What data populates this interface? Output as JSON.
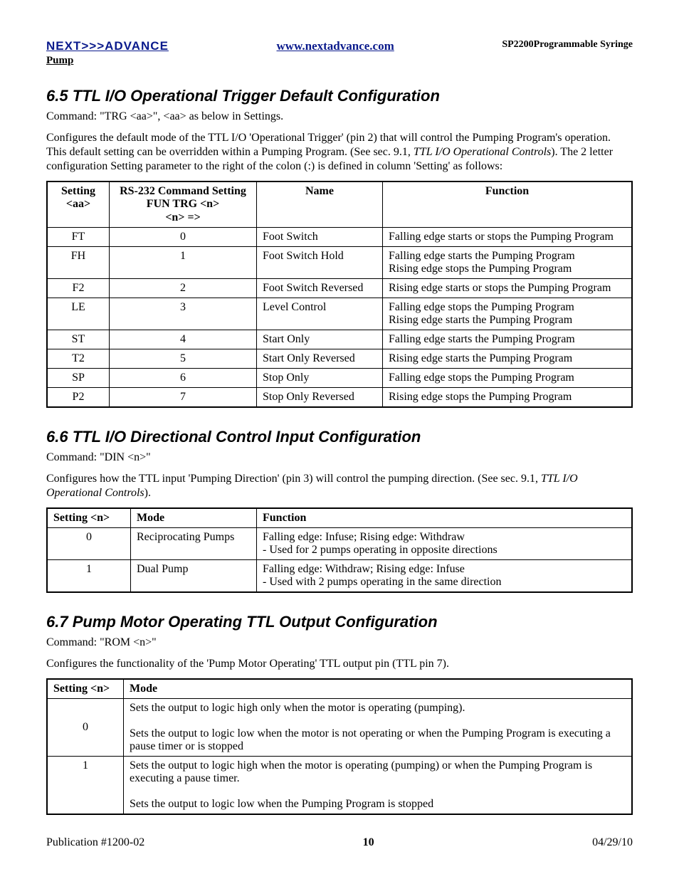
{
  "header": {
    "brand": "NEXT>>>ADVANCE",
    "url": "www.nextadvance.com",
    "product": "SP2200Programmable Syringe",
    "pump_label": "Pump"
  },
  "s65": {
    "heading": "6.5  TTL I/O Operational Trigger Default Configuration",
    "cmd": "Command:  \"TRG <aa>\",  <aa> as below in Settings.",
    "desc_a": "Configures the default mode of  the TTL I/O 'Operational Trigger' (pin 2) that will control the Pumping Program's operation.  This default setting can be overridden within a Pumping Program.  (See sec. 9.1, ",
    "desc_i": "TTL I/O Operational Controls",
    "desc_b": "). The 2 letter configuration Setting parameter to the right of the colon (:) is defined in column 'Setting' as follows:",
    "headers": {
      "c1a": "Setting",
      "c1b": "<aa>",
      "c2a": "RS-232 Command Setting",
      "c2b": "FUN TRG <n>",
      "c2c": "<n> =>",
      "c3": "Name",
      "c4": "Function"
    },
    "rows": [
      {
        "s": "FT",
        "r": "0",
        "n": "Foot Switch",
        "f": "Falling edge starts or stops the Pumping Program"
      },
      {
        "s": "FH",
        "r": "1",
        "n": "Foot Switch Hold",
        "f": "Falling edge starts the Pumping Program\nRising edge stops the Pumping Program"
      },
      {
        "s": "F2",
        "r": "2",
        "n": "Foot Switch Reversed",
        "f": "Rising edge starts or stops the Pumping Program"
      },
      {
        "s": "LE",
        "r": "3",
        "n": "Level Control",
        "f": "Falling edge stops the Pumping Program\nRising edge starts the Pumping Program"
      },
      {
        "s": "ST",
        "r": "4",
        "n": "Start Only",
        "f": "Falling edge starts the Pumping Program"
      },
      {
        "s": "T2",
        "r": "5",
        "n": "Start Only Reversed",
        "f": "Rising edge starts the Pumping Program"
      },
      {
        "s": "SP",
        "r": "6",
        "n": "Stop Only",
        "f": "Falling edge stops the Pumping Program"
      },
      {
        "s": "P2",
        "r": "7",
        "n": "Stop Only Reversed",
        "f": "Rising edge stops the Pumping Program"
      }
    ]
  },
  "s66": {
    "heading": "6.6  TTL I/O Directional Control Input Configuration",
    "cmd": "Command: \"DIN <n>\"",
    "desc_a": "Configures how the TTL input 'Pumping Direction' (pin 3) will control the pumping direction.  (See sec. 9.1, ",
    "desc_i": "TTL I/O Operational Controls",
    "desc_b": ").",
    "headers": {
      "c1": "Setting <n>",
      "c2": "Mode",
      "c3": "Function"
    },
    "rows": [
      {
        "s": "0",
        "m": "Reciprocating Pumps",
        "f": "Falling edge: Infuse; Rising edge: Withdraw\n- Used for 2 pumps operating in opposite directions"
      },
      {
        "s": "1",
        "m": "Dual Pump",
        "f": "Falling edge: Withdraw; Rising edge: Infuse\n- Used with 2 pumps operating in the same direction"
      }
    ]
  },
  "s67": {
    "heading": "6.7  Pump Motor Operating TTL Output Configuration",
    "cmd": "Command: \"ROM <n>\"",
    "desc": "Configures the functionality of the 'Pump Motor Operating' TTL output pin (TTL pin 7).",
    "headers": {
      "c1": "Setting <n>",
      "c2": "Mode"
    },
    "rows": [
      {
        "s": "0",
        "m": "Sets the output to logic high only when the motor is operating (pumping).\n\nSets the output to logic low when the motor is not operating or when the Pumping Program is executing a pause timer or is stopped"
      },
      {
        "s": "1",
        "m": "Sets the output to logic high when the motor is operating (pumping) or when the Pumping Program is executing a pause timer.\n\nSets the output to logic low when the Pumping Program is stopped"
      }
    ]
  },
  "footer": {
    "left": "Publication #1200-02",
    "page": "10",
    "right": "04/29/10"
  }
}
